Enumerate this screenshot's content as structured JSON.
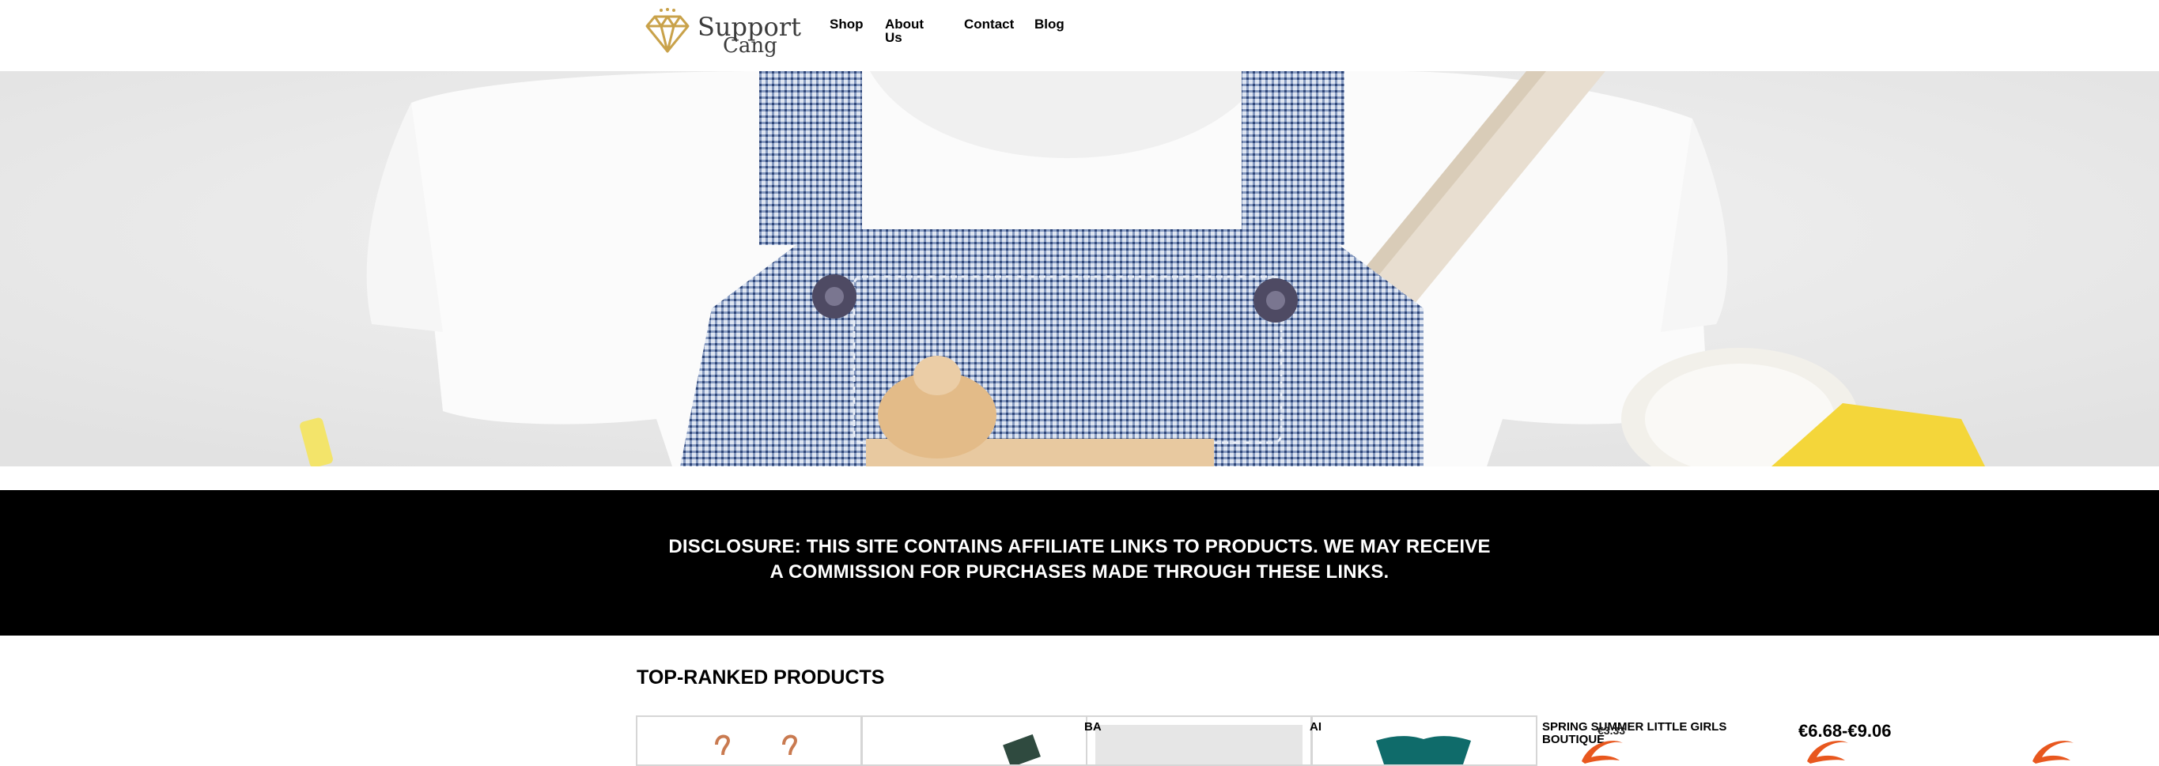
{
  "brand": {
    "name_line1": "Support",
    "name_line2": "Cang",
    "logo_icon": "diamond-logo-icon",
    "accent": "#c9a24a"
  },
  "nav": {
    "items": [
      "Shop",
      "About Us",
      "Contact",
      "Blog"
    ]
  },
  "hero": {
    "image": "baby-overalls-photo"
  },
  "disclosure": {
    "text": "DISCLOSURE: THIS SITE CONTAINS AFFILIATE LINKS TO PRODUCTS. WE MAY RECEIVE A COMMISSION FOR PURCHASES MADE THROUGH THESE LINKS."
  },
  "products": {
    "title": "TOP-RANKED PRODUCTS",
    "cards": [
      {
        "title": "",
        "image": "hangers-image"
      },
      {
        "title": "BA",
        "image": "book-image"
      },
      {
        "title": "AI",
        "image": "gray-fabric-image"
      },
      {
        "title": "",
        "image": "teal-shirt-image"
      }
    ],
    "listing_title": "SPRING SUMMER LITTLE GIRLS BOUTIQUE",
    "listing_overlap": "€3.33",
    "price": "€6.68-€9.06",
    "marketplace_icon": "alibaba-logo-icon",
    "colors": {
      "marketplace": "#e8571e",
      "disclosure_bg": "#000000"
    }
  }
}
